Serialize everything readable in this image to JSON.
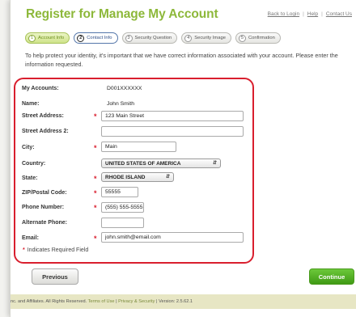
{
  "header": {
    "title": "Register for Manage My Account",
    "links": [
      "Back to Login",
      "Help",
      "Contact Us"
    ]
  },
  "steps": [
    {
      "num": "1",
      "label": "Account Info",
      "state": "done"
    },
    {
      "num": "2",
      "label": "Contact Info",
      "state": "active"
    },
    {
      "num": "3",
      "label": "Security Question",
      "state": "todo"
    },
    {
      "num": "4",
      "label": "Security Image",
      "state": "todo"
    },
    {
      "num": "5",
      "label": "Confirmation",
      "state": "todo"
    }
  ],
  "intro": "To help protect your identity, it's important that we have correct information associated with your account. Please enter the information requested.",
  "form": {
    "account_label": "My Accounts:",
    "account_value": "D001XXXXXX",
    "name_label": "Name:",
    "name_value": "John Smith",
    "street_label": "Street Address:",
    "street_value": "123 Main Street",
    "street2_label": "Street Address 2:",
    "street2_value": "",
    "city_label": "City:",
    "city_value": "Main",
    "country_label": "Country:",
    "country_value": "UNITED STATES OF AMERICA",
    "state_label": "State:",
    "state_value": "RHODE ISLAND",
    "zip_label": "ZIP/Postal Code:",
    "zip_value": "55555",
    "phone_label": "Phone Number:",
    "phone_value": "(555) 555-5555",
    "altphone_label": "Alternate Phone:",
    "altphone_value": "",
    "email_label": "Email:",
    "email_value": "john.smith@email.com",
    "required_marker": "*",
    "required_note": "Indicates Required Field"
  },
  "buttons": {
    "previous": "Previous",
    "continue": "Continue"
  },
  "footer": {
    "text": "nc. and Affiliates. All Rights Reserved.",
    "terms": "Terms of Use",
    "privacy": "Privacy & Security",
    "version": "Version: 2.5.62.1"
  },
  "colors": {
    "brand_green": "#8db83a",
    "required_red": "#d91f2e",
    "continue_green": "#3f9a14"
  }
}
